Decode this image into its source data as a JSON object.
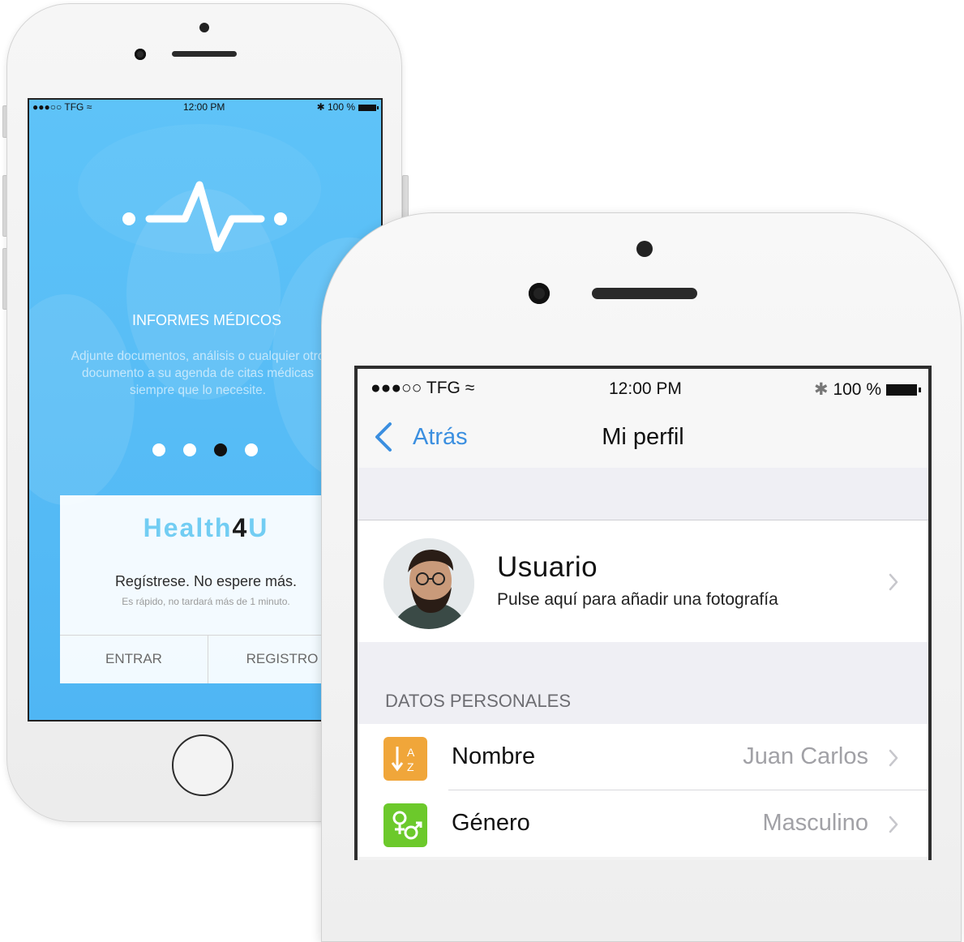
{
  "colors": {
    "accent_blue": "#3b8fe0",
    "onboarding_bg": "#5ec3f8",
    "brand_light": "#72cdf3",
    "icon_orange": "#f0a63a",
    "icon_green": "#6cc92b"
  },
  "phone1": {
    "status": {
      "carrier": "●●●○○ TFG",
      "time": "12:00 PM",
      "battery": "100 %"
    },
    "logo_icon": "heartbeat-icon",
    "title": "INFORMES MÉDICOS",
    "description": "Adjunte documentos, análisis o cualquier otro documento a su agenda de citas médicas siempre que lo necesite.",
    "pages": {
      "count": 4,
      "active": 3
    },
    "brand": {
      "part1": "Health",
      "part2": "4",
      "part3": "U"
    },
    "register_main": "Regístrese. No espere más.",
    "register_sub": "Es rápido, no tardará más de 1 minuto.",
    "enter_label": "ENTRAR",
    "register_label": "REGISTRO"
  },
  "phone2": {
    "status": {
      "carrier": "●●●○○ TFG",
      "time": "12:00 PM",
      "battery": "100 %"
    },
    "nav": {
      "back_label": "Atrás",
      "title": "Mi perfil"
    },
    "profile": {
      "name": "Usuario",
      "hint": "Pulse aquí para añadir una fotografía"
    },
    "section_label": "DATOS PERSONALES",
    "rows": [
      {
        "icon": "sort-az-icon",
        "icon_text": "A Z",
        "label": "Nombre",
        "value": "Juan Carlos"
      },
      {
        "icon": "gender-icon",
        "icon_text": "♀♂",
        "label": "Género",
        "value": "Masculino"
      }
    ]
  }
}
